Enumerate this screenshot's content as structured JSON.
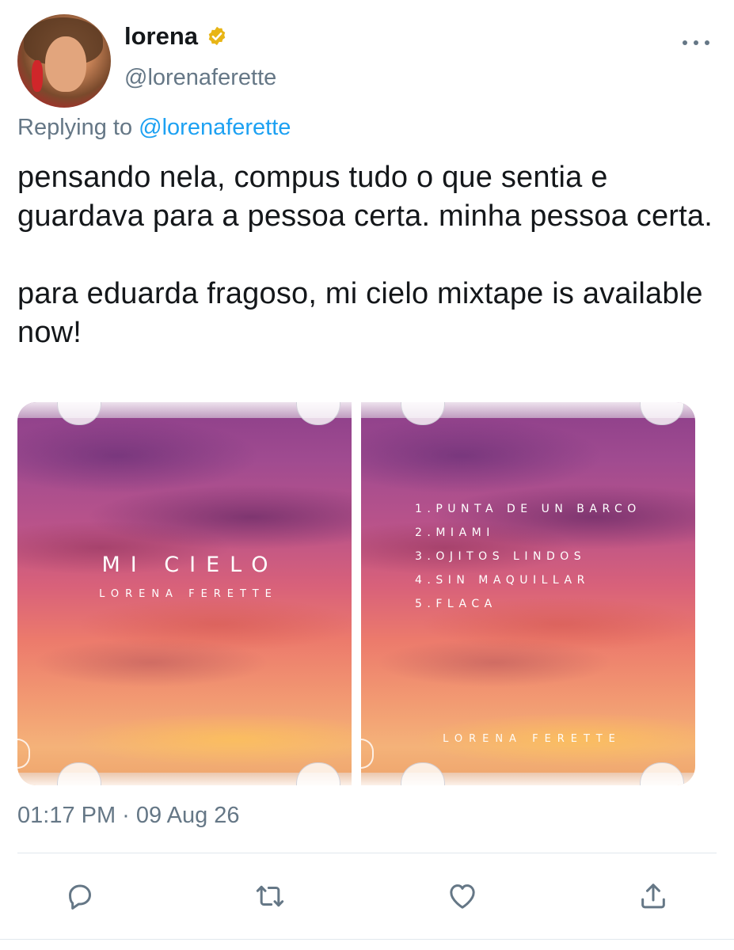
{
  "user": {
    "display_name": "lorena",
    "handle": "@lorenaferette",
    "verified": true,
    "verified_color": "#e8b516"
  },
  "reply": {
    "prefix": "Replying to",
    "mention": "@lorenaferette"
  },
  "tweet": {
    "text": "pensando nela, compus tudo o que sentia e guardava para a pessoa certa. minha pessoa certa.\n\npara eduarda fragoso, mi cielo mixtape is available now!",
    "timestamp": "01:17 PM · 09 Aug 26"
  },
  "media": {
    "front_cover": {
      "title": "MI CIELO",
      "artist": "LORENA FERETTE"
    },
    "back_cover": {
      "tracks": [
        "1.PUNTA DE UN BARCO",
        "2.MIAMI",
        "3.OJITOS LINDOS",
        "4.SIN MAQUILLAR",
        "5.FLACA"
      ],
      "artist": "LORENA FERETTE"
    }
  },
  "actions": [
    {
      "name": "reply-icon"
    },
    {
      "name": "retweet-icon"
    },
    {
      "name": "like-icon"
    },
    {
      "name": "share-icon"
    }
  ],
  "colors": {
    "text": "#14171a",
    "secondary": "#657786",
    "link": "#1da1f2",
    "divider": "#e1e8ed"
  }
}
